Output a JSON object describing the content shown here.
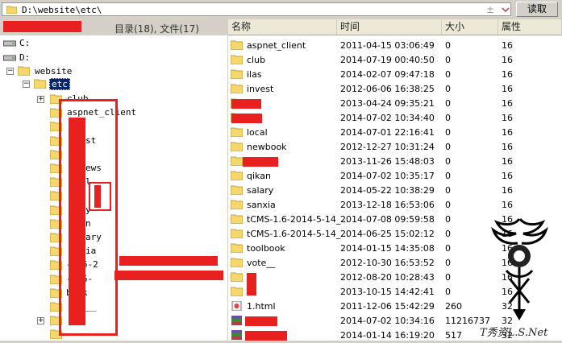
{
  "pathbar": {
    "path": "D:\\website\\etc\\",
    "plus_minus": "±",
    "read_label": "读取"
  },
  "status": {
    "text": "目录(18), 文件(17)"
  },
  "tree": {
    "drives": [
      "C:",
      "D:"
    ],
    "website": "website",
    "etc": "etc",
    "children": [
      {
        "label": "club"
      },
      {
        "label": "aspnet_client"
      },
      {
        "label": ""
      },
      {
        "label": "st"
      },
      {
        "label": ""
      },
      {
        "label": "ews"
      },
      {
        "label": "l"
      },
      {
        "label": ""
      },
      {
        "label": "y"
      },
      {
        "label": "n"
      },
      {
        "label": "ary"
      },
      {
        "label": "ia"
      },
      {
        "label": "-1.6-2"
      },
      {
        "label": "-1.6-"
      },
      {
        "label": "book"
      },
      {
        "label": "__"
      },
      {
        "label": ""
      },
      {
        "label": ""
      }
    ]
  },
  "columns": {
    "name": "名称",
    "time": "时间",
    "size": "大小",
    "attr": "属性"
  },
  "files": [
    {
      "name": "aspnet_client",
      "time": "2011-04-15 03:06:49",
      "size": "0",
      "attr": "16",
      "type": "folder"
    },
    {
      "name": "club",
      "time": "2014-07-19 00:40:50",
      "size": "0",
      "attr": "16",
      "type": "folder"
    },
    {
      "name": "ilas",
      "time": "2014-02-07 09:47:18",
      "size": "0",
      "attr": "16",
      "type": "folder"
    },
    {
      "name": "invest",
      "time": "2012-06-06 16:38:25",
      "size": "0",
      "attr": "16",
      "type": "folder"
    },
    {
      "name": "",
      "time": "2013-04-24 09:35:21",
      "size": "0",
      "attr": "16",
      "type": "folder"
    },
    {
      "name": "",
      "time": "2014-07-02 10:34:40",
      "size": "0",
      "attr": "16",
      "type": "folder"
    },
    {
      "name": "local",
      "time": "2014-07-01 22:16:41",
      "size": "0",
      "attr": "16",
      "type": "folder"
    },
    {
      "name": "newbook",
      "time": "2012-12-27 10:31:24",
      "size": "0",
      "attr": "16",
      "type": "folder"
    },
    {
      "name": "",
      "time": "2013-11-26 15:48:03",
      "size": "0",
      "attr": "16",
      "type": "folder"
    },
    {
      "name": "qikan",
      "time": "2014-07-02 10:35:17",
      "size": "0",
      "attr": "16",
      "type": "folder"
    },
    {
      "name": "salary",
      "time": "2014-05-22 10:38:29",
      "size": "0",
      "attr": "16",
      "type": "folder"
    },
    {
      "name": "sanxia",
      "time": "2013-12-18 16:53:06",
      "size": "0",
      "attr": "16",
      "type": "folder"
    },
    {
      "name": "tCMS-1.6-2014-5-14_...",
      "time": "2014-07-08 09:59:58",
      "size": "0",
      "attr": "16",
      "type": "folder"
    },
    {
      "name": "tCMS-1.6-2014-5-14_...",
      "time": "2014-06-25 15:02:12",
      "size": "0",
      "attr": "16",
      "type": "folder"
    },
    {
      "name": "toolbook",
      "time": "2014-01-15 14:35:08",
      "size": "0",
      "attr": "16",
      "type": "folder"
    },
    {
      "name": "vote__",
      "time": "2012-10-30 16:53:52",
      "size": "0",
      "attr": "16",
      "type": "folder"
    },
    {
      "name": "",
      "time": "2012-08-20 10:28:43",
      "size": "0",
      "attr": "16",
      "type": "folder"
    },
    {
      "name": "",
      "time": "2013-10-15 14:42:41",
      "size": "0",
      "attr": "16",
      "type": "folder"
    },
    {
      "name": "1.html",
      "time": "2011-12-06 15:42:29",
      "size": "260",
      "attr": "32",
      "type": "html"
    },
    {
      "name": "",
      "time": "2014-07-02 10:34:16",
      "size": "11216737",
      "attr": "32",
      "type": "rar"
    },
    {
      "name": "",
      "time": "2014-01-14 16:19:20",
      "size": "517",
      "attr": "32",
      "type": "rar"
    }
  ],
  "watermark": {
    "text": "T秀资L.S.Net"
  },
  "colors": {
    "redaction": "#e82020",
    "folder": "#f5d76e",
    "selection": "#0a246a"
  }
}
